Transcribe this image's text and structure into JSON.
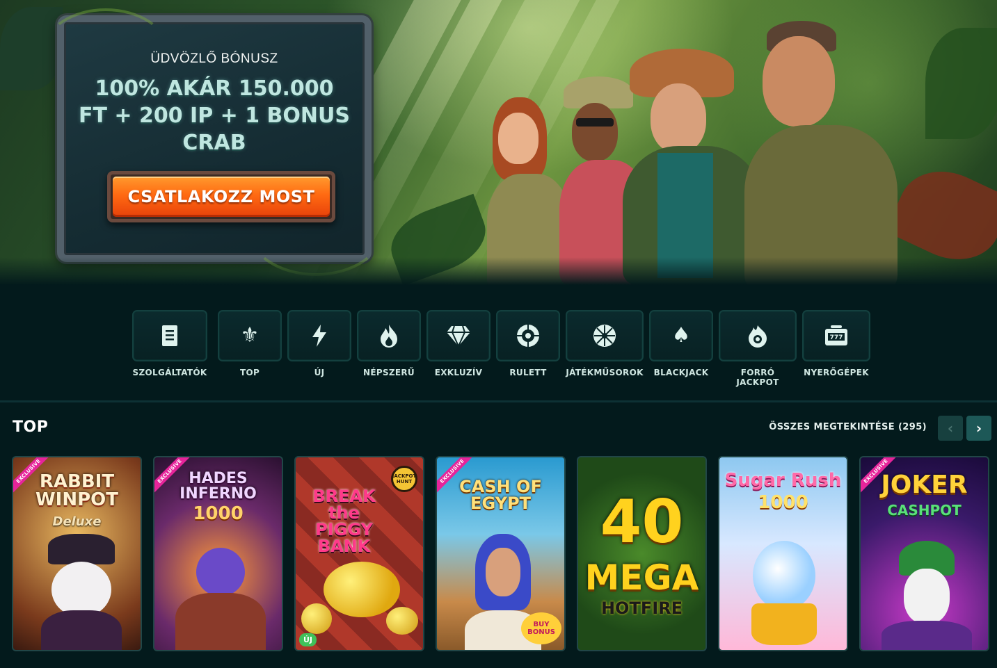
{
  "hero": {
    "kicker": "ÜDVÖZLŐ BÓNUSZ",
    "offer_line1": "100% AKÁR 150.000",
    "offer_line2": "FT + 200 IP + 1 BONUS",
    "offer_line3": "CRAB",
    "cta_label": "CSATLAKOZZ MOST"
  },
  "categories": [
    {
      "label": "SZOLGÁLTATÓK",
      "icon": "document-icon"
    },
    {
      "label": "TOP",
      "icon": "fleur-de-lis-icon"
    },
    {
      "label": "ÚJ",
      "icon": "lightning-icon"
    },
    {
      "label": "NÉPSZERŰ",
      "icon": "flame-icon"
    },
    {
      "label": "EXKLUZÍV",
      "icon": "diamond-icon"
    },
    {
      "label": "RULETT",
      "icon": "roulette-icon"
    },
    {
      "label": "JÁTÉKMŰSOROK",
      "icon": "wheel-icon"
    },
    {
      "label": "BLACKJACK",
      "icon": "spade-icon"
    },
    {
      "label": "FORRÓ JACKPOT",
      "icon": "hot-jackpot-icon"
    },
    {
      "label": "NYERŐGÉPEK",
      "icon": "slot-machine-icon"
    }
  ],
  "top_section": {
    "title": "TOP",
    "view_all": "ÖSSZES MEGTEKINTÉSE (295)",
    "prev_icon": "chevron-left-icon",
    "next_icon": "chevron-right-icon"
  },
  "games": [
    {
      "title": "RABBIT WINPOT",
      "subtitle": "Deluxe",
      "ribbon": "EXCLUSIVE",
      "accent": "#c64a2a"
    },
    {
      "title": "HADES INFERNO",
      "subtitle": "1000",
      "ribbon": "EXCLUSIVE",
      "accent": "#6a3b7a"
    },
    {
      "title": "BREAK the PIGGY BANK",
      "subtitle": "",
      "badge": "ÚJ",
      "hunt": "JACKPOT HUNT",
      "accent": "#f2c21e"
    },
    {
      "title": "CASH OF EGYPT",
      "subtitle": "BUY BONUS",
      "ribbon": "EXCLUSIVE",
      "accent": "#e9a23a"
    },
    {
      "title": "40 MEGA",
      "subtitle": "HOTFIRE",
      "accent": "#f3d21b"
    },
    {
      "title": "Sugar Rush",
      "subtitle": "1000",
      "accent": "#ff8fb6"
    },
    {
      "title": "JOKER",
      "subtitle": "CASHPOT",
      "ribbon": "EXCLUSIVE",
      "accent": "#ffd23a"
    }
  ]
}
